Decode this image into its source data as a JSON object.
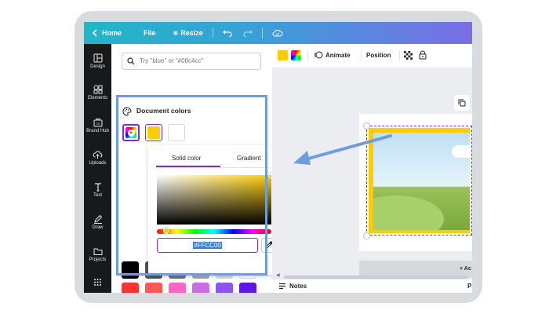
{
  "topbar": {
    "home": "Home",
    "file": "File",
    "resize": "Resize"
  },
  "sidebar": {
    "items": [
      {
        "label": "Design",
        "icon": "layout-icon"
      },
      {
        "label": "Elements",
        "icon": "shapes-icon"
      },
      {
        "label": "Brand Hub",
        "icon": "brand-hub-icon"
      },
      {
        "label": "Uploads",
        "icon": "cloud-upload-icon"
      },
      {
        "label": "Text",
        "icon": "text-icon"
      },
      {
        "label": "Draw",
        "icon": "pen-icon"
      },
      {
        "label": "Projects",
        "icon": "folder-icon"
      }
    ]
  },
  "panel": {
    "search_placeholder": "Try \"blue\" or \"#00c4cc\"",
    "document_colors_title": "Document colors"
  },
  "picker": {
    "tab_solid": "Solid color",
    "tab_gradient": "Gradient",
    "hex_value": "#FFCC00",
    "selected_color": "#ffcc00"
  },
  "palette": [
    "#000000",
    "#555555",
    "#737373",
    "#a6a6a6",
    "#d9d9d9",
    "#ffffff",
    "#ff3131",
    "#ff5757",
    "#ff66c4",
    "#cb6ce6",
    "#8c52ff",
    "#5e17eb",
    "#0097b2",
    "#0cc0df",
    "#5ce1e6",
    "#38b6ff",
    "#5271ff",
    "#004aad"
  ],
  "toolbar": {
    "animate": "Animate",
    "position": "Position"
  },
  "canvas": {
    "add_page": "+ Ac"
  },
  "bottombar": {
    "notes": "Notes",
    "right_initial": "P"
  }
}
